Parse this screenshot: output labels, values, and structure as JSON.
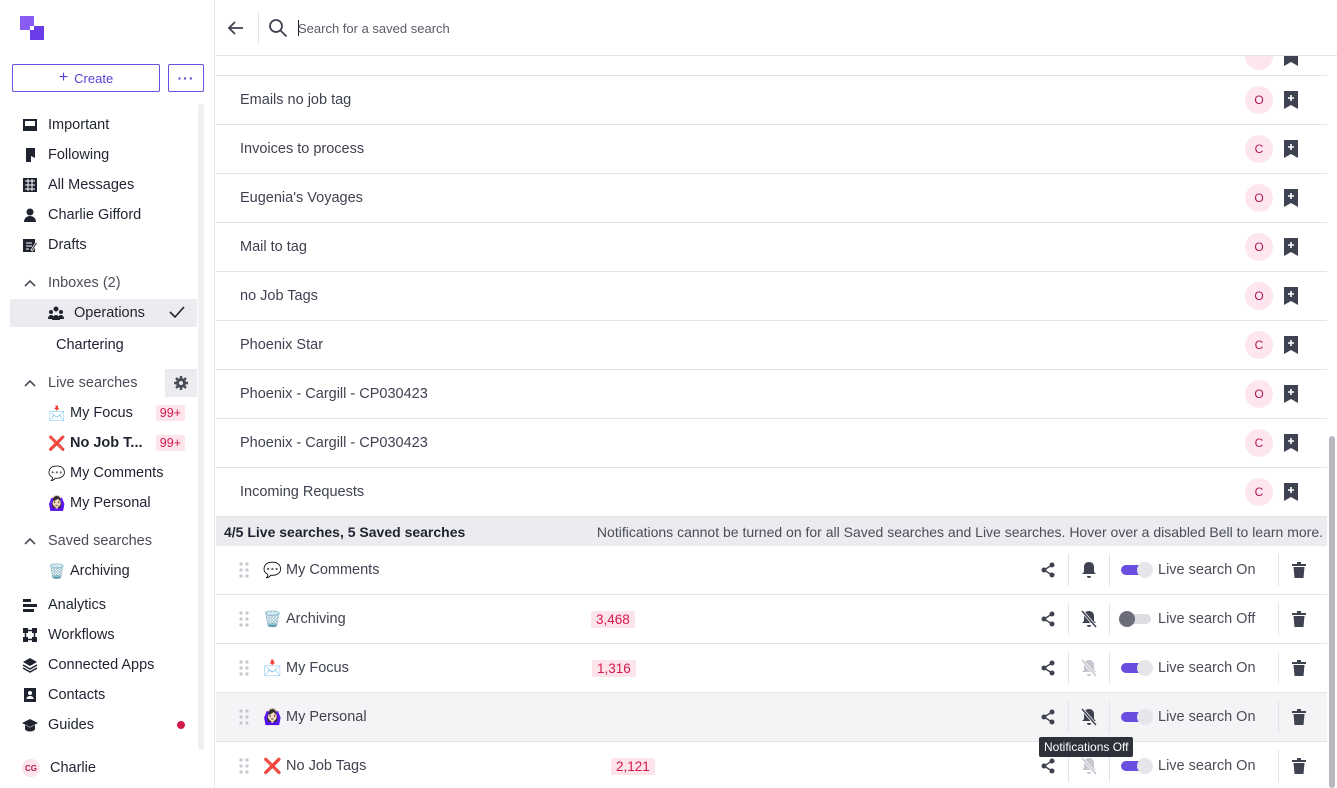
{
  "sidebar": {
    "create_label": "Create",
    "more_label": "···",
    "nav": [
      {
        "label": "Important",
        "icon": "inbox-icon"
      },
      {
        "label": "Following",
        "icon": "flag-icon"
      },
      {
        "label": "All Messages",
        "icon": "grid-icon"
      },
      {
        "label": "Charlie Gifford",
        "icon": "person-icon"
      },
      {
        "label": "Drafts",
        "icon": "draft-icon"
      }
    ],
    "inboxes_label": "Inboxes (2)",
    "inboxes": [
      {
        "label": "Operations",
        "icon": "team-icon"
      },
      {
        "label": "Chartering"
      }
    ],
    "live_searches_label": "Live searches",
    "live_searches": [
      {
        "emoji": "📩",
        "label": "My Focus",
        "badge": "99+"
      },
      {
        "emoji": "❌",
        "label": "No Job T...",
        "badge": "99+"
      },
      {
        "emoji": "💬",
        "label": "My Comments"
      },
      {
        "emoji": "🙆🏻‍♀️",
        "label": "My Personal"
      }
    ],
    "saved_searches_label": "Saved searches",
    "saved_searches": [
      {
        "emoji": "🗑️",
        "label": "Archiving"
      }
    ],
    "bottom_nav": [
      {
        "label": "Analytics",
        "icon": "analytics-icon"
      },
      {
        "label": "Workflows",
        "icon": "workflow-icon"
      },
      {
        "label": "Connected Apps",
        "icon": "layers-icon"
      },
      {
        "label": "Contacts",
        "icon": "contacts-icon"
      },
      {
        "label": "Guides",
        "icon": "graduation-cap-icon"
      }
    ],
    "user": {
      "initials": "CG",
      "name": "Charlie"
    }
  },
  "search": {
    "placeholder": "Search for a saved search"
  },
  "saved_list": [
    {
      "name": "Emails no job tag",
      "owner": "O"
    },
    {
      "name": "Invoices to process",
      "owner": "C"
    },
    {
      "name": "Eugenia's Voyages",
      "owner": "O"
    },
    {
      "name": "Mail to tag",
      "owner": "O"
    },
    {
      "name": "no Job Tags",
      "owner": "O"
    },
    {
      "name": "Phoenix Star",
      "owner": "C"
    },
    {
      "name": "Phoenix - Cargill - CP030423",
      "owner": "O"
    },
    {
      "name": "Phoenix - Cargill - CP030423",
      "owner": "C"
    },
    {
      "name": "Incoming Requests",
      "owner": "C"
    }
  ],
  "summary": {
    "count": "4/5 Live searches, 5 Saved searches",
    "note": "Notifications cannot be turned on for all Saved searches and Live searches. Hover over a disabled Bell to learn more."
  },
  "live_list": [
    {
      "emoji": "💬",
      "name": "My Comments",
      "count": "",
      "bell": "on",
      "toggle": "on",
      "status": "Live search On"
    },
    {
      "emoji": "🗑️",
      "name": "Archiving",
      "count": "3,468",
      "bell": "off",
      "toggle": "off",
      "status": "Live search Off"
    },
    {
      "emoji": "📩",
      "name": "My Focus",
      "count": "1,316",
      "bell": "disabled",
      "toggle": "on",
      "status": "Live search On"
    },
    {
      "emoji": "🙆🏻‍♀️",
      "name": "My Personal",
      "count": "",
      "bell": "off",
      "toggle": "on",
      "status": "Live search On"
    },
    {
      "emoji": "❌",
      "name": "No Job Tags",
      "count": "2,121",
      "bell": "disabled",
      "toggle": "on",
      "status": "Live search On"
    }
  ],
  "tooltip": "Notifications Off",
  "colors": {
    "accent": "#6a4ee0",
    "badge_text": "#d4194c",
    "badge_bg": "#fde4ea"
  }
}
